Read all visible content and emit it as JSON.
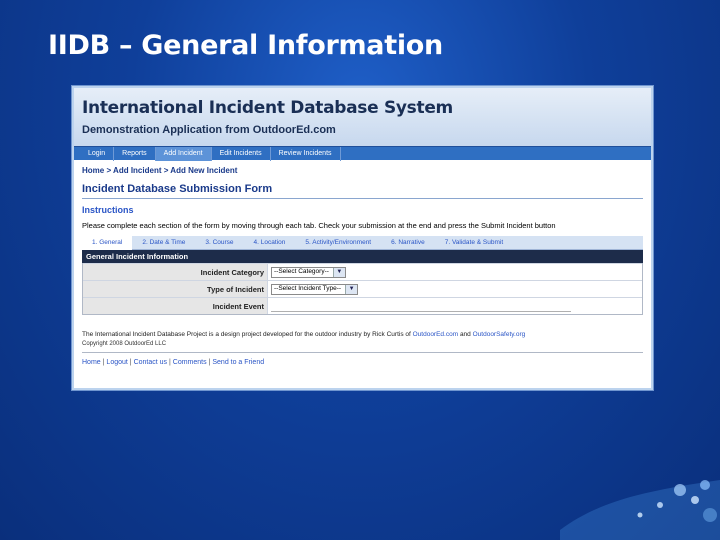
{
  "slide": {
    "title": "IIDB – General Information"
  },
  "app": {
    "title": "International Incident Database System",
    "subtitle": "Demonstration Application from OutdoorEd.com"
  },
  "menu": {
    "items": [
      {
        "label": "Login"
      },
      {
        "label": "Reports"
      },
      {
        "label": "Add Incident"
      },
      {
        "label": "Edit Incidents"
      },
      {
        "label": "Review Incidents"
      }
    ],
    "active_index": 2
  },
  "breadcrumb": "Home > Add Incident > Add New Incident",
  "form": {
    "title": "Incident Database Submission Form",
    "instructions_heading": "Instructions",
    "instructions_text": "Please complete each section of the form by moving through each tab. Check your submission at the end and press the Submit Incident button",
    "tabs": [
      {
        "label": "1. General"
      },
      {
        "label": "2. Date & Time"
      },
      {
        "label": "3. Course"
      },
      {
        "label": "4. Location"
      },
      {
        "label": "5. Activity/Environment"
      },
      {
        "label": "6. Narrative"
      },
      {
        "label": "7. Validate & Submit"
      }
    ],
    "section_title": "General Incident Information",
    "fields": {
      "category_label": "Incident Category",
      "category_value": "--Select Category--",
      "type_label": "Type of Incident",
      "type_value": "--Select Incident Type--",
      "event_label": "Incident Event"
    }
  },
  "footer": {
    "text_before": "The International Incident Database Project is a design project developed for the outdoor industry by Rick Curtis of ",
    "link1": "OutdoorEd.com",
    "text_mid": " and ",
    "link2": "OutdoorSafety.org",
    "copyright": "Copyright 2008 OutdoorEd LLC",
    "links": [
      {
        "label": "Home"
      },
      {
        "label": "Logout"
      },
      {
        "label": "Contact us"
      },
      {
        "label": "Comments"
      },
      {
        "label": "Send to a Friend"
      }
    ]
  }
}
